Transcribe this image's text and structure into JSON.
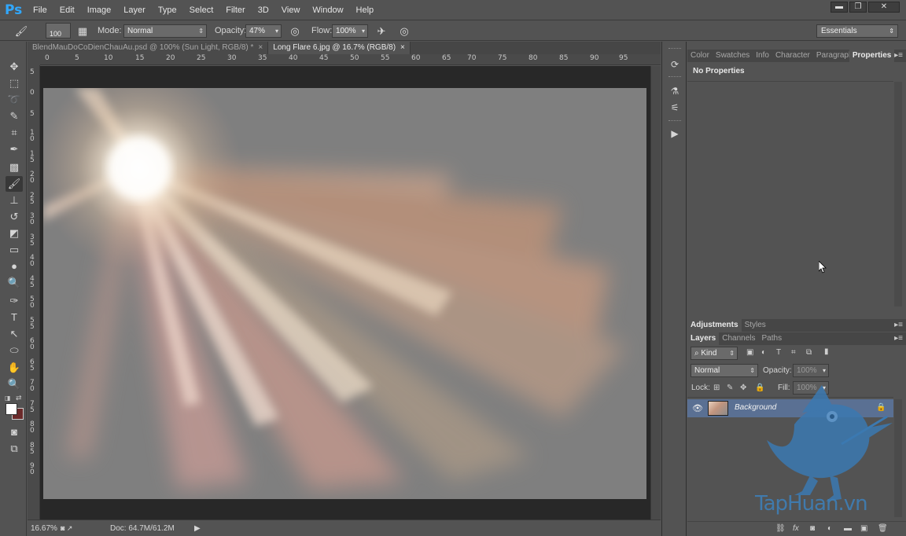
{
  "app": {
    "logo": "Ps",
    "window_buttons": [
      "▬",
      "❐",
      "✕"
    ]
  },
  "menu": [
    "File",
    "Edit",
    "Image",
    "Layer",
    "Type",
    "Select",
    "Filter",
    "3D",
    "View",
    "Window",
    "Help"
  ],
  "options": {
    "brush_size": "100",
    "mode_label": "Mode:",
    "mode_value": "Normal",
    "opacity_label": "Opacity:",
    "opacity_value": "47%",
    "flow_label": "Flow:",
    "flow_value": "100%",
    "workspace": "Essentials"
  },
  "document_tabs": [
    {
      "label": "BlendMauDoCoDienChauAu.psd @ 100% (Sun Light, RGB/8) *",
      "active": false
    },
    {
      "label": "Long Flare 6.jpg @ 16.7% (RGB/8)",
      "active": true
    }
  ],
  "tab_close": "×",
  "ruler_top": [
    "0",
    "5",
    "10",
    "15",
    "20",
    "25",
    "30",
    "35",
    "40",
    "45",
    "50",
    "55",
    "60",
    "65",
    "70",
    "75",
    "80",
    "85",
    "90",
    "95"
  ],
  "ruler_left": [
    "5",
    "0",
    "5",
    "1\n0",
    "1\n5",
    "2\n0",
    "2\n5",
    "3\n0",
    "3\n5",
    "4\n0",
    "4\n5",
    "5\n0",
    "5\n5",
    "6\n0",
    "6\n5",
    "7\n0",
    "7\n5",
    "8\n0",
    "8\n5",
    "9\n0"
  ],
  "status": {
    "zoom": "16.67%",
    "doc": "Doc: 64.7M/61.2M"
  },
  "properties_panel": {
    "tabs": [
      "Color",
      "Swatches",
      "Info",
      "Character",
      "Paragraph",
      "Properties"
    ],
    "active_tab": "Properties",
    "content": "No Properties"
  },
  "adjustments_panel": {
    "tabs": [
      "Adjustments",
      "Styles"
    ]
  },
  "layers_panel": {
    "tabs": [
      "Layers",
      "Channels",
      "Paths"
    ],
    "filter_kind": "Kind",
    "blend_mode": "Normal",
    "opacity_label": "Opacity:",
    "opacity_value": "100%",
    "lock_label": "Lock:",
    "fill_label": "Fill:",
    "fill_value": "100%",
    "layers": [
      {
        "name": "Background",
        "locked": true,
        "visible": true
      }
    ],
    "footer_icons": [
      "link-icon",
      "fx-icon",
      "mask-icon",
      "adjustment-icon",
      "group-icon",
      "new-layer-icon",
      "trash-icon"
    ]
  },
  "watermark": "TapHuan.vn"
}
